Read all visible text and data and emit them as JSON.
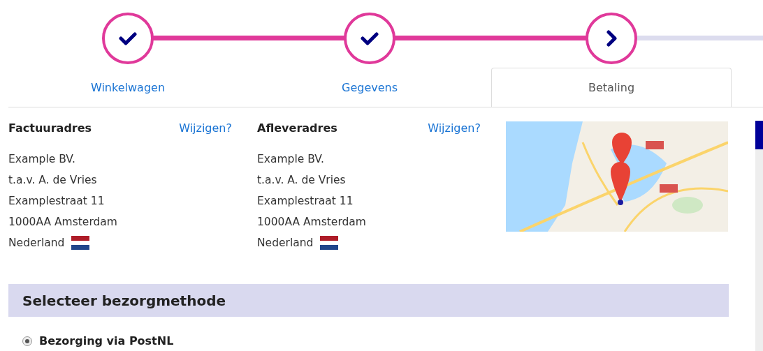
{
  "steps": [
    {
      "label": "Winkelwagen",
      "completed": true,
      "selected": false
    },
    {
      "label": "Gegevens",
      "completed": true,
      "selected": false
    },
    {
      "label": "Betaling",
      "completed": false,
      "selected": true
    }
  ],
  "addresses": [
    {
      "title": "Factuuradres",
      "edit_link": "Wijzigen?",
      "lines": [
        "Example BV.",
        "t.a.v. A. de Vries",
        "Examplestraat 11",
        "1000AA Amsterdam",
        "Nederland"
      ]
    },
    {
      "title": "Afleveradres",
      "edit_link": "Wijzigen?",
      "lines": [
        "Example BV.",
        "t.a.v. A. de Vries",
        "Examplestraat 11",
        "1000AA Amsterdam",
        "Nederland"
      ]
    }
  ],
  "delivery": {
    "heading": "Selecteer bezorgmethode",
    "options": [
      {
        "label": "Bezorging via PostNL",
        "selected": true
      }
    ]
  }
}
